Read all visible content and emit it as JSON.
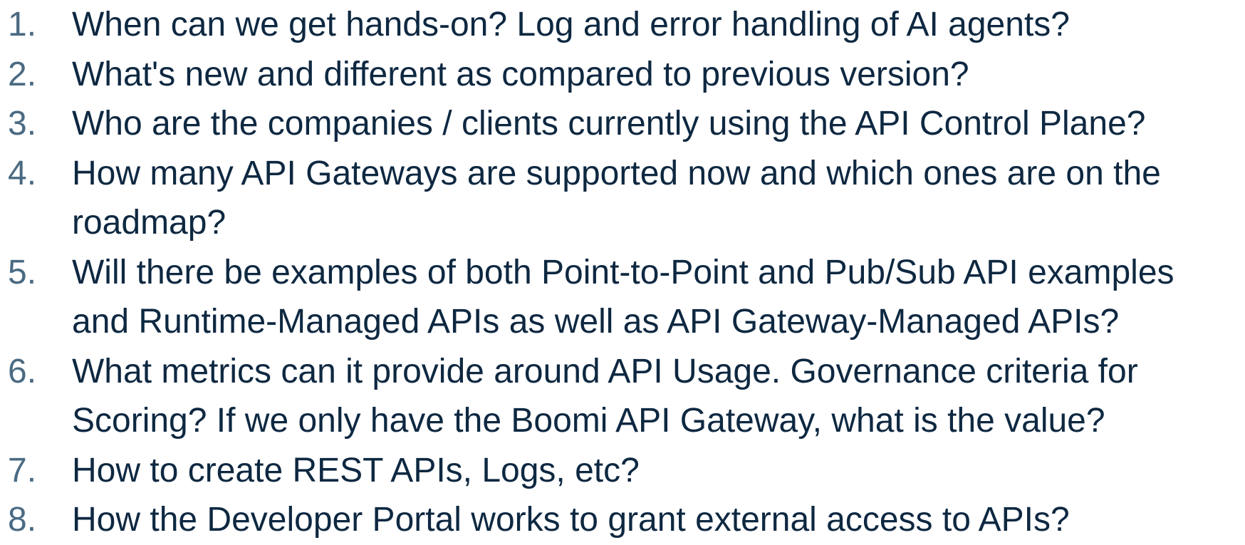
{
  "questions": [
    {
      "number": "1.",
      "lines": [
        "When can we get hands-on? Log and error handling of AI agents?"
      ]
    },
    {
      "number": "2.",
      "lines": [
        "What's new and different as compared to previous version?"
      ]
    },
    {
      "number": "3.",
      "lines": [
        "Who are the companies / clients currently using the API Control Plane?"
      ]
    },
    {
      "number": "4.",
      "lines": [
        "How many API Gateways are supported now and which ones are on the",
        "roadmap?"
      ]
    },
    {
      "number": "5.",
      "lines": [
        "Will there be examples of both Point-to-Point and Pub/Sub API examples",
        "and Runtime-Managed APIs as well as API Gateway-Managed APIs?"
      ]
    },
    {
      "number": "6.",
      "lines": [
        "What metrics can it provide around API Usage. Governance criteria for",
        "Scoring? If we only have the Boomi API Gateway, what is the value?"
      ]
    },
    {
      "number": "7.",
      "lines": [
        "How to create REST APIs, Logs, etc?"
      ]
    },
    {
      "number": "8.",
      "lines": [
        "How the Developer Portal works to grant external access to APIs?"
      ]
    }
  ],
  "colors": {
    "text": "#0e2841",
    "number": "#4a6a82",
    "background": "#ffffff"
  }
}
